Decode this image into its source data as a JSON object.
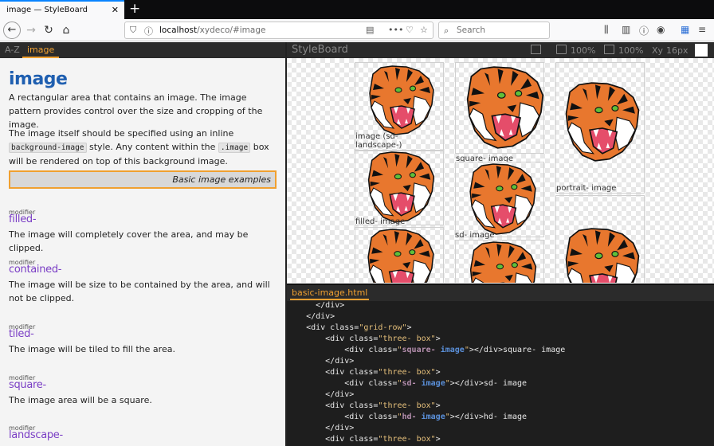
{
  "browser": {
    "tab_title": "image — StyleBoard",
    "tab_close": "✕",
    "new_tab": "+",
    "url_host": "localhost",
    "url_path": "/xydeco/#image",
    "search_placeholder": "Search"
  },
  "left": {
    "tabs": [
      "A-Z",
      "image"
    ],
    "title": "image",
    "intro": "A rectangular area that contains an image. The image pattern provides control over the size and cropping of the image.",
    "p2_a": "The image itself should be specified using an inline ",
    "p2_code1": "background-image",
    "p2_b": " style. Any content within the ",
    "p2_code2": ".image",
    "p2_c": " box will be rendered on top of this background image.",
    "examples_label": "Basic image examples",
    "modifiers": [
      {
        "label": "modifier",
        "name": "filled-",
        "desc": "The image will completely cover the area, and may be clipped."
      },
      {
        "label": "modifier",
        "name": "contained-",
        "desc": "The image will be size to be contained by the area, and will not be clipped."
      },
      {
        "label": "modifier",
        "name": "tiled-",
        "desc": "The image will be tiled to fill the area."
      },
      {
        "label": "modifier",
        "name": "square-",
        "desc": "The image area will be a square."
      },
      {
        "label": "modifier",
        "name": "landscape-",
        "desc": ""
      }
    ]
  },
  "toolbar": {
    "title": "StyleBoard",
    "zoom1": "100%",
    "zoom2": "100%",
    "font_size": "16px"
  },
  "preview": {
    "labels": [
      "image (sd- landscape-)",
      "square- image",
      "portrait- image",
      "filled- image",
      "sd- image"
    ]
  },
  "code": {
    "tab": "basic-image.html",
    "lines": [
      "      </div>",
      "    </div>",
      "    <div class=\"grid-row\">",
      "        <div class=\"three- box\">",
      "            <div class=\"square- image\"></div>square- image",
      "        </div>",
      "        <div class=\"three- box\">",
      "            <div class=\"sd- image\"></div>sd- image",
      "        </div>",
      "        <div class=\"three- box\">",
      "            <div class=\"hd- image\"></div>hd- image",
      "        </div>",
      "        <div class=\"three- box\">"
    ]
  }
}
